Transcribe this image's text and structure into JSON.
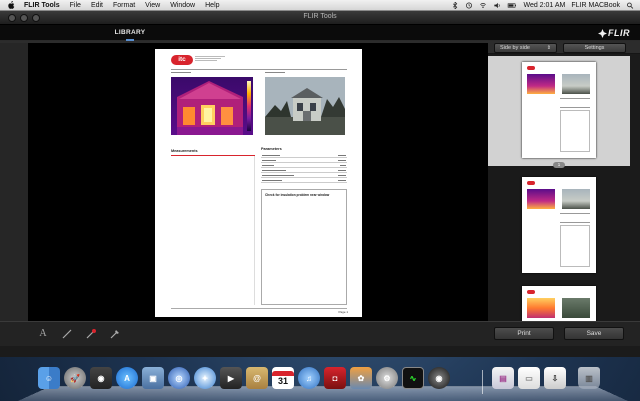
{
  "menubar": {
    "app_name": "FLIR Tools",
    "menus": [
      "File",
      "Edit",
      "Format",
      "View",
      "Window",
      "Help"
    ],
    "clock": "Wed 2:01 AM",
    "computer_name": "FLIR MACBook",
    "icons": [
      "apple-icon",
      "bluetooth-icon",
      "time-machine-icon",
      "wifi-icon",
      "volume-icon",
      "battery-icon",
      "spotlight-icon"
    ]
  },
  "window": {
    "title": "FLIR Tools",
    "tab_label": "LIBRARY",
    "brand": "FLIR"
  },
  "subbar": {
    "view_mode": "Side by side",
    "settings_label": "Settings"
  },
  "report": {
    "logo_text": "itc",
    "sections": {
      "measurements": "Measurements",
      "parameters": "Parameters"
    },
    "note": "Check for insulation problem near window",
    "page_number": "Page 1"
  },
  "buttons": {
    "print": "Print",
    "save": "Save"
  },
  "thumbnails": {
    "badge": "1"
  },
  "tools": [
    "text-tool-icon",
    "line-tool-icon",
    "marker-tool-icon",
    "pin-tool-icon"
  ],
  "dock": {
    "icons": [
      "finder-icon",
      "launchpad-icon",
      "dashboard-icon",
      "app-store-icon",
      "preview-icon",
      "safari-globe-icon",
      "safari-icon",
      "facetime-icon",
      "contacts-icon",
      "calendar-icon",
      "itunes-icon",
      "photo-booth-icon",
      "iphoto-icon",
      "system-preferences-icon",
      "activity-monitor-icon",
      "flir-tools-icon",
      "documents-icon",
      "pages-icon",
      "downloads-icon",
      "trash-icon"
    ],
    "calendar_day": "31"
  },
  "colors": {
    "accent_red": "#d8242d",
    "tab_indicator": "#5a8fd0"
  }
}
